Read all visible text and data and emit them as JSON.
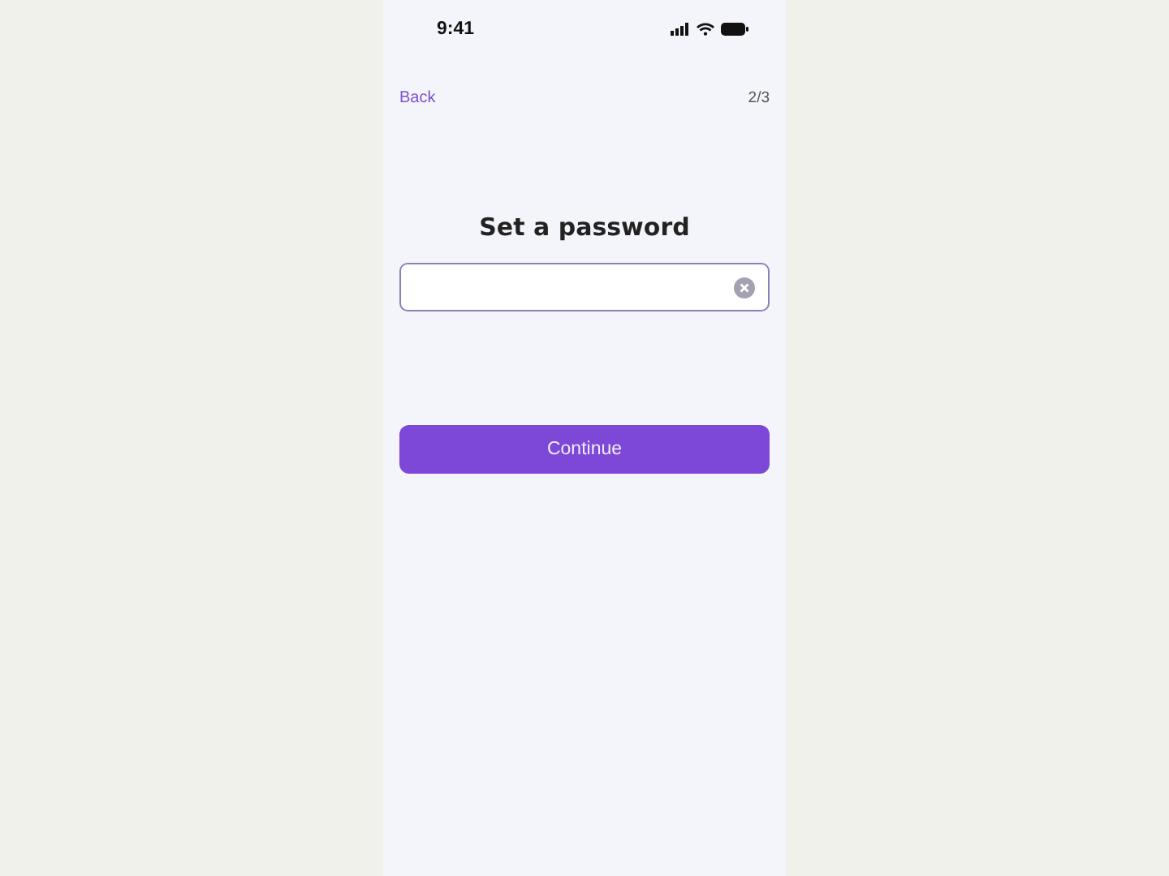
{
  "status_bar": {
    "time": "9:41"
  },
  "nav": {
    "back": "Back",
    "step": "2/3"
  },
  "title": "Set a password",
  "password_field": {
    "clear_button": true
  },
  "continue_button": {
    "label": "Continue"
  }
}
